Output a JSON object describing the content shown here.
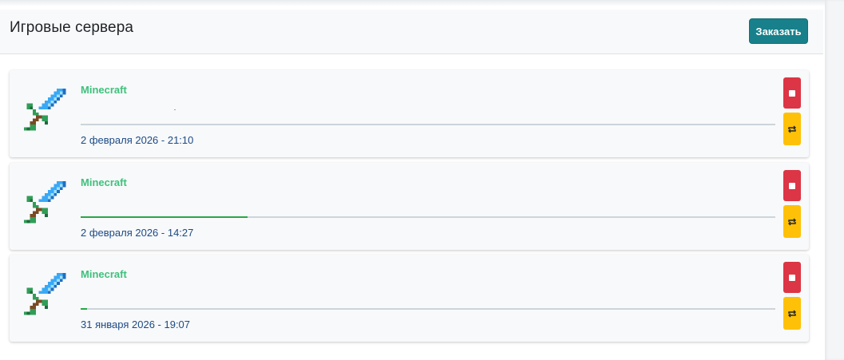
{
  "header": {
    "title": "Игровые сервера",
    "order_button_label": "Заказать"
  },
  "servers": [
    {
      "name": "Minecraft",
      "date": "2 февраля 2026 - 21:10",
      "progress": 0.0
    },
    {
      "name": "Minecraft",
      "date": "2 февраля 2026 - 14:27",
      "progress": 0.24
    },
    {
      "name": "Minecraft",
      "date": "31 января 2026 - 19:07",
      "progress": 0.009
    }
  ],
  "icons": {
    "server": "minecraft-sword-icon",
    "stop": "stop-icon",
    "restart": "restart-icon"
  },
  "colors": {
    "primary_button": "#17808a",
    "server_name": "#3ec17c",
    "date_text": "#1c4a86",
    "progress_fill": "#28a745",
    "stop": "#dc3545",
    "restart": "#ffc107"
  }
}
